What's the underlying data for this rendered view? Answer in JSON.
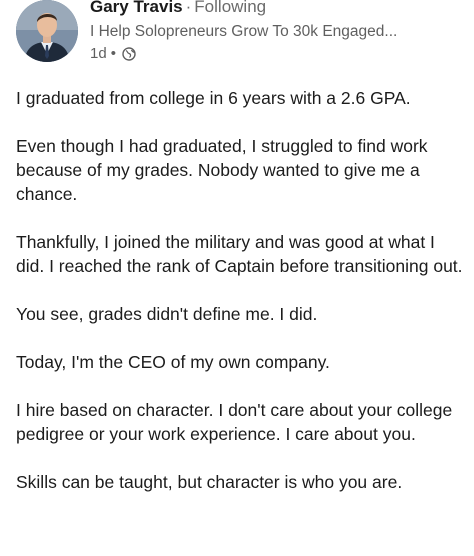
{
  "author": {
    "name": "Gary Travis",
    "separator": "·",
    "follow_status": "Following",
    "headline": "I Help Solopreneurs Grow To 30k Engaged...",
    "time": "1d",
    "time_separator": "•",
    "visibility_icon": "globe-icon"
  },
  "post": {
    "paragraphs": [
      "I graduated from college in 6 years with a 2.6 GPA.",
      "Even though I had graduated, I struggled to find work because of my grades. Nobody wanted to give me a chance.",
      "Thankfully, I joined the military and was good at what I did. I reached the rank of Captain before transitioning out.",
      "You see, grades didn't define me. I did.",
      "Today, I'm the CEO of my own company.",
      "I hire based on character. I don't care about your college pedigree or your work experience. I care about you.",
      "Skills can be taught, but character is who you are."
    ]
  }
}
